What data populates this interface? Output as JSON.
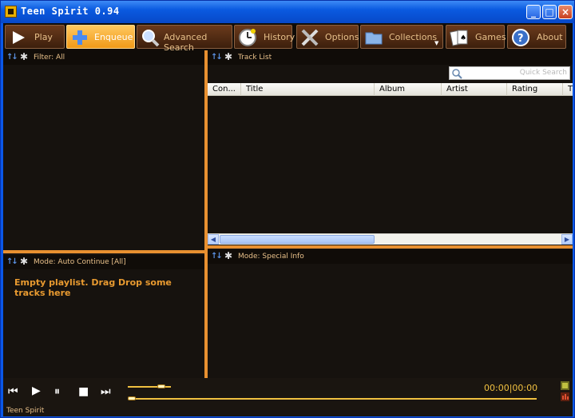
{
  "window": {
    "title": "Teen Spirit 0.94",
    "controls": {
      "minimize": "_",
      "maximize": "□",
      "close": "×"
    }
  },
  "toolbar": {
    "buttons": [
      {
        "label": "Play",
        "icon": "play-icon"
      },
      {
        "label": "Enqueue",
        "icon": "plus-icon",
        "active": true
      },
      {
        "label": "Advanced Search",
        "icon": "search-icon"
      },
      {
        "label": "History",
        "icon": "clock-icon"
      },
      {
        "label": "Options",
        "icon": "tools-icon"
      },
      {
        "label": "Collections",
        "icon": "folder-icon"
      },
      {
        "label": "Games",
        "icon": "cards-icon"
      },
      {
        "label": "About",
        "icon": "help-icon"
      }
    ]
  },
  "panes": {
    "filter": {
      "title": "Filter: All"
    },
    "tracklist": {
      "title": "Track List",
      "quick_search_placeholder": "Quick Search",
      "columns": [
        "Con...",
        "Title",
        "Album",
        "Artist",
        "Rating",
        "T"
      ]
    },
    "playlist": {
      "title": "Mode: Auto Continue [All]",
      "empty_message": "Empty playlist. Drag Drop some tracks here"
    },
    "info": {
      "title": "Mode: Special Info"
    }
  },
  "transport": {
    "time": "00:00|00:00",
    "status": "Teen Spirit",
    "volume_fraction": 0.85,
    "progress_fraction": 0.0
  },
  "colors": {
    "accent": "#e89030",
    "text": "#e8c08a",
    "background": "#16120e",
    "titlebar": "#0a5ae0"
  }
}
